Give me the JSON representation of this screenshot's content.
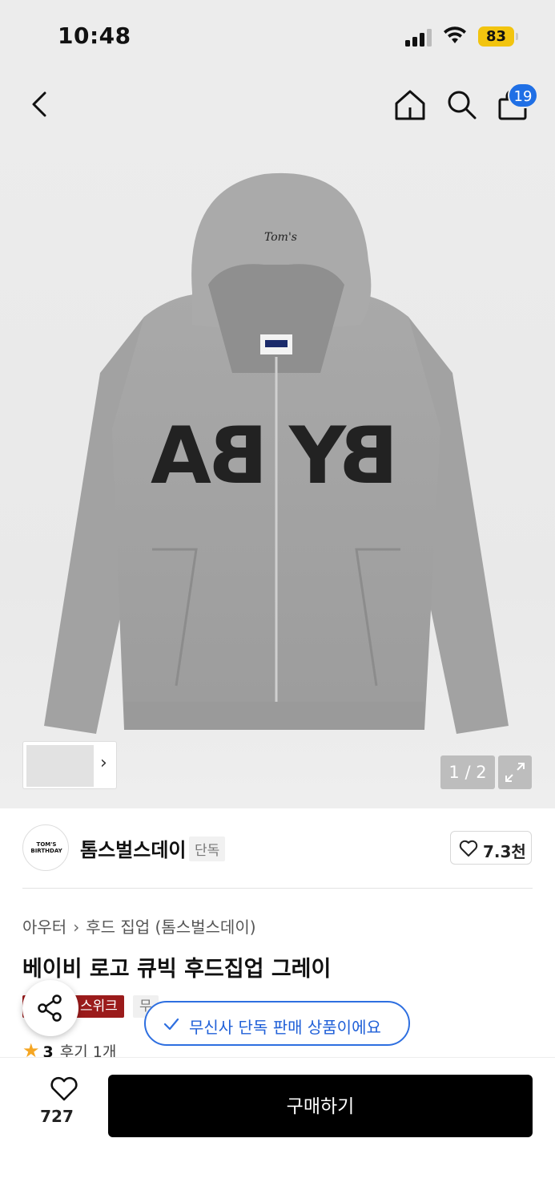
{
  "status": {
    "time": "10:48",
    "battery": "83"
  },
  "nav": {
    "cart_count": "19"
  },
  "gallery": {
    "counter": "1 / 2",
    "print_left": "BA",
    "print_right": "BY",
    "hood_logo": "Tom's"
  },
  "brand": {
    "logo_text": "TOM'S BIRTHDAY",
    "name": "톰스벌스데이",
    "tag": "단독",
    "likes": "7.3천"
  },
  "breadcrumb": {
    "category": "아우터",
    "subcategory": "후드 집업 (톰스벌스데이)"
  },
  "product": {
    "title": "베이비 로고 큐빅 후드집업 그레이"
  },
  "badges": {
    "red": "스위크",
    "gray": "무"
  },
  "toast": {
    "message": "무신사 단독 판매 상품이에요"
  },
  "rating": {
    "score": "3",
    "reviews": "후기 1개"
  },
  "bottom": {
    "wish_count": "727",
    "buy_label": "구매하기"
  },
  "colors": {
    "accent_blue": "#2e6fe0",
    "badge_red": "#9b1b1b",
    "star": "#f5a623"
  }
}
